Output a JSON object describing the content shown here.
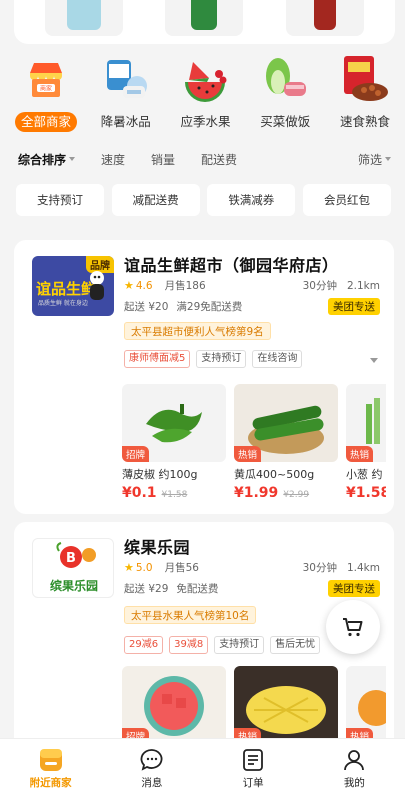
{
  "categories": [
    {
      "label": "全部商家",
      "icon": "store-icon",
      "active": true
    },
    {
      "label": "降暑冰品",
      "icon": "ice-cream-icon",
      "active": false
    },
    {
      "label": "应季水果",
      "icon": "watermelon-icon",
      "active": false
    },
    {
      "label": "买菜做饭",
      "icon": "vegetables-icon",
      "active": false
    },
    {
      "label": "速食熟食",
      "icon": "cooked-food-icon",
      "active": false
    }
  ],
  "sort": {
    "items": [
      "综合排序",
      "速度",
      "销量",
      "配送费"
    ],
    "filter": "筛选"
  },
  "chips": [
    "支持预订",
    "减配送费",
    "铁满减券",
    "会员红包"
  ],
  "stores": [
    {
      "name": "谊品生鲜超市（御园华府店）",
      "brand_badge": "品牌",
      "logo_text": "谊品生鲜",
      "logo_sub": "品质生鲜 就在身边",
      "rating": "4.6",
      "monthly_sales": "月售186",
      "time": "30分钟",
      "distance": "2.1km",
      "min_order": "起送 ¥20",
      "delivery": "满29免配送费",
      "delivery_tag": "美团专送",
      "rank": "太平县超市便利人气榜第9名",
      "tags": [
        {
          "text": "康师傅面减5",
          "red": true
        },
        {
          "text": "支持预订",
          "red": false
        },
        {
          "text": "在线咨询",
          "red": false
        }
      ],
      "products": [
        {
          "name": "薄皮椒 约100g",
          "badge": "招牌",
          "price": "¥0.1",
          "orig": "¥1.58"
        },
        {
          "name": "黄瓜400~500g",
          "badge": "热销",
          "price": "¥1.99",
          "orig": "¥2.99"
        },
        {
          "name": "小葱 约",
          "badge": "热销",
          "price": "¥1.58",
          "orig": ""
        }
      ]
    },
    {
      "name": "缤果乐园",
      "logo_text": "缤果乐园",
      "rating": "5.0",
      "monthly_sales": "月售56",
      "time": "30分钟",
      "distance": "1.4km",
      "min_order": "起送 ¥29",
      "delivery": "免配送费",
      "delivery_tag": "美团专送",
      "rank": "太平县水果人气榜第10名",
      "tags": [
        {
          "text": "29减6",
          "red": true
        },
        {
          "text": "39减8",
          "red": true
        },
        {
          "text": "支持预订",
          "red": false
        },
        {
          "text": "售后无忧",
          "red": false
        }
      ],
      "products": [
        {
          "badge": "招牌"
        },
        {
          "badge": "热销"
        },
        {
          "badge": "热销"
        }
      ]
    }
  ],
  "nav": [
    {
      "label": "附近商家",
      "icon": "store-nav-icon",
      "active": true
    },
    {
      "label": "消息",
      "icon": "message-icon",
      "active": false
    },
    {
      "label": "订单",
      "icon": "order-icon",
      "active": false
    },
    {
      "label": "我的",
      "icon": "profile-icon",
      "active": false
    }
  ],
  "colors": {
    "accent": "#ff7a00",
    "price": "#f0372c",
    "meituan": "#ffd100"
  }
}
